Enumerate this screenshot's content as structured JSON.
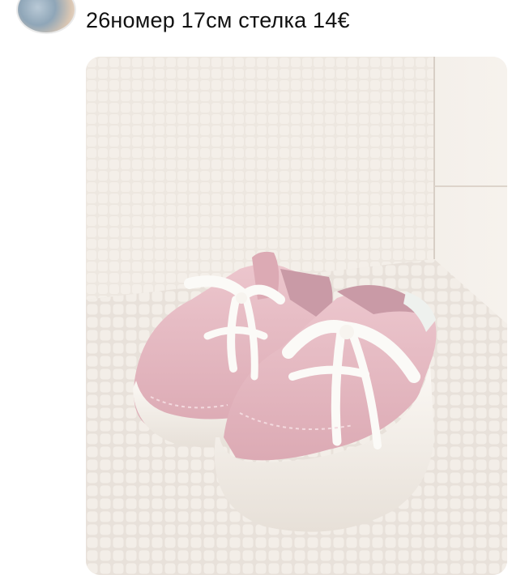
{
  "message": {
    "text": "26номер 17см стелка 14€"
  },
  "photo": {
    "alt": "pink-white-kids-sneakers-photo"
  },
  "colors": {
    "background": "#ffffff",
    "text": "#111111",
    "shoe_pink": "#e7bfc7",
    "shoe_sole": "#f4efe9",
    "laces": "#fbfaf7",
    "cushion": "#ece6df"
  }
}
